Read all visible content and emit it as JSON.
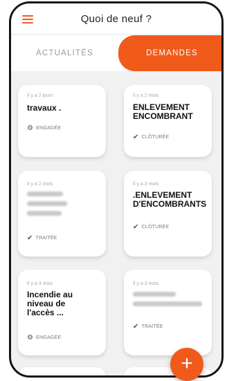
{
  "header": {
    "title": "Quoi de neuf ?",
    "menu_icon": "hamburger-menu-icon"
  },
  "tabs": [
    {
      "label": "ACTUALITÉS"
    },
    {
      "label": "DEMANDES"
    }
  ],
  "accent_color": "#f05a1a",
  "cards": [
    {
      "time": "Il y a 2 jours",
      "title": "travaux .",
      "status": "ENGAGÉE",
      "status_icon": "gear-icon"
    },
    {
      "time": "Il y a 2 mois",
      "title": "ENLEVEMENT ENCOMBRANT",
      "status": "CLÔTURÉE",
      "status_icon": "check-icon"
    },
    {
      "time": "Il y a 2 mois",
      "title": "",
      "status": "TRAITÉE",
      "status_icon": "check-icon"
    },
    {
      "time": "Il y a 3 mois",
      "title": ".ENLEVEMENT D'ENCOMBRANTS",
      "status": "CLÔTURÉE",
      "status_icon": "check-icon"
    },
    {
      "time": "Il y a 3 mois",
      "title": "Incendie au niveau de l'accès ...",
      "status": "ENGAGÉE",
      "status_icon": "gear-icon"
    },
    {
      "time": "Il y a 3 mois",
      "title": "",
      "status": "TRAITÉE",
      "status_icon": "check-icon"
    }
  ],
  "fab": {
    "label": "+"
  }
}
